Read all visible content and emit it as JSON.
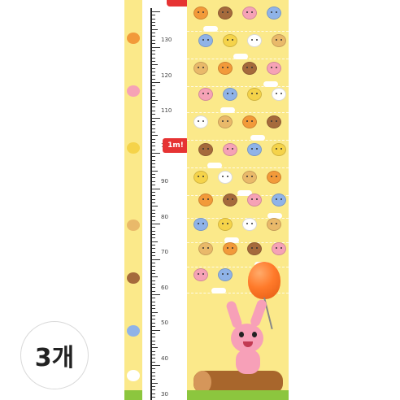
{
  "ruler": {
    "ticks": [
      "130",
      "120",
      "110",
      "100",
      "90",
      "80",
      "70",
      "60",
      "50",
      "40",
      "30"
    ],
    "marker": "1m!"
  },
  "badge": {
    "quantity": "3개"
  },
  "colors": {
    "background": "#fbe98a",
    "marker": "#e63333",
    "balloon": "#ff7a2a",
    "rabbit": "#f7a0b8"
  }
}
